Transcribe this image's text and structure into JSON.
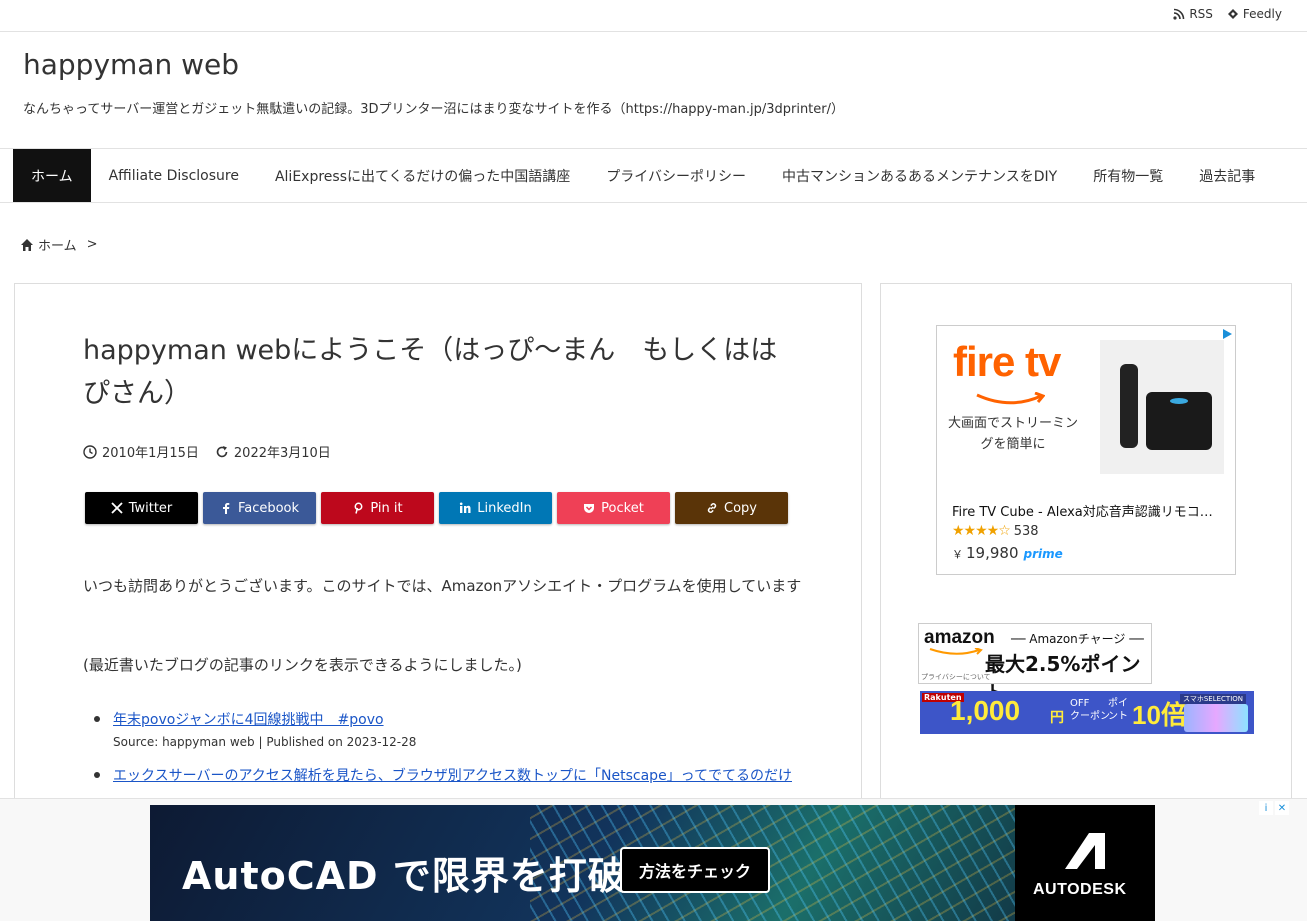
{
  "topbar": {
    "rss_label": "RSS",
    "feedly_label": "Feedly"
  },
  "header": {
    "title": "happyman web",
    "description": "なんちゃってサーバー運営とガジェット無駄遣いの記録。3Dプリンター沼にはまり変なサイトを作る（https://happy-man.jp/3dprinter/）"
  },
  "nav": {
    "items": [
      {
        "label": "ホーム"
      },
      {
        "label": "Affiliate Disclosure"
      },
      {
        "label": "AliExpressに出てくるだけの偏った中国語講座"
      },
      {
        "label": "プライバシーポリシー"
      },
      {
        "label": "中古マンションあるあるメンテナンスをDIY"
      },
      {
        "label": "所有物一覧"
      },
      {
        "label": "過去記事"
      }
    ]
  },
  "breadcrumb": {
    "home_label": "ホーム",
    "separator": ">"
  },
  "post": {
    "title": "happyman webにようこそ（はっぴ～まん　もしくははぴさん）",
    "published": "2010年1月15日",
    "updated": "2022年3月10日",
    "shares": [
      {
        "label": "Twitter"
      },
      {
        "label": "Facebook"
      },
      {
        "label": "Pin it"
      },
      {
        "label": "LinkedIn"
      },
      {
        "label": "Pocket"
      },
      {
        "label": "Copy"
      }
    ],
    "para1": "いつも訪問ありがとうございます。このサイトでは、Amazonアソシエイト・プログラムを使用しています",
    "para2": "(最近書いたブログの記事のリンクを表示できるようにしました。)",
    "recent": [
      {
        "title": "年末povoジャンボに4回線挑戦中　#povo",
        "source": "Source: happyman web | Published on 2023-12-28"
      },
      {
        "title": "エックスサーバーのアクセス解析を見たら、ブラウザ別アクセス数トップに「Netscape」ってでてるのだけ",
        "source": ""
      }
    ]
  },
  "sidebar": {
    "firetv": {
      "logo": "fire tv",
      "tagline": "大画面でストリーミングを簡単に",
      "product_name": "Fire TV Cube - Alexa対応音声認識リモコ…",
      "stars": "★★★★☆",
      "reviews": "538",
      "currency": "￥",
      "price": "19,980",
      "prime": "prime"
    },
    "amazon_ad": {
      "logo": "amazon",
      "charge": "── Amazonチャージ ──",
      "percent": "最大2.5%ポイント",
      "privacy": "プライバシーについて"
    },
    "rakuten_ad": {
      "brand": "Rakuten",
      "amount": "1,000",
      "yen": "円",
      "off": "OFF\nクーポン",
      "point": "ポイ\nント",
      "multiplier": "10倍も",
      "selection": "スマホSELECTION"
    }
  },
  "bottom_ad": {
    "headline": "AutoCAD で限界を打破",
    "button": "方法をチェック",
    "brand": "AUTODESK",
    "info": "i",
    "close": "✕"
  },
  "colors": {
    "nav_active_bg": "#111111",
    "link": "#1a55c7",
    "twitter": "#000000",
    "facebook": "#3b5998",
    "pinterest": "#bd081c",
    "linkedin": "#0077b5",
    "pocket": "#ef4056",
    "copy": "#5a3408",
    "firetv_orange": "#ff6200"
  },
  "icons": [
    "rss-icon",
    "feedly-icon",
    "home-icon",
    "clock-icon",
    "refresh-icon",
    "x-icon",
    "facebook-icon",
    "pinterest-icon",
    "linkedin-icon",
    "pocket-icon",
    "link-icon",
    "adchoices-icon",
    "autodesk-logo-icon"
  ]
}
